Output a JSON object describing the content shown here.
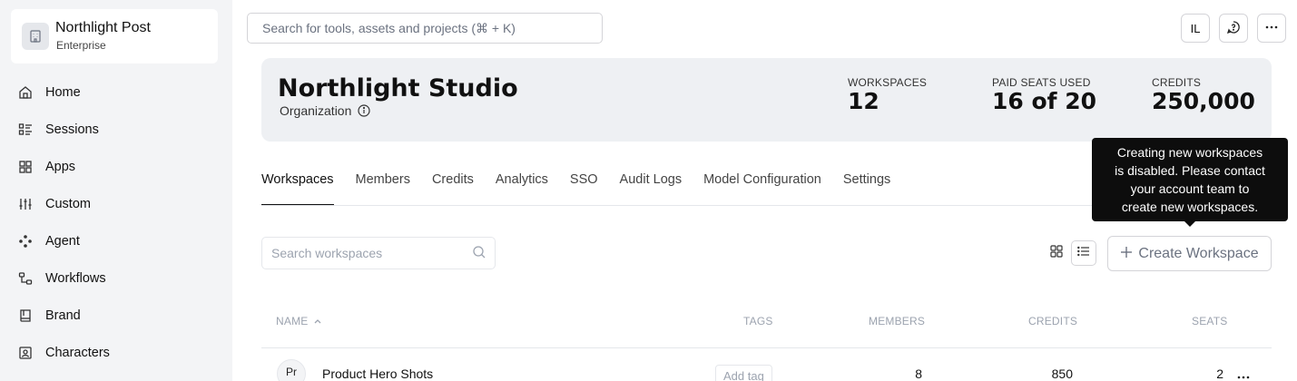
{
  "sidebar": {
    "org_name": "Northlight Post",
    "org_plan": "Enterprise",
    "items": [
      {
        "label": "Home",
        "icon": "home-icon"
      },
      {
        "label": "Sessions",
        "icon": "sessions-icon"
      },
      {
        "label": "Apps",
        "icon": "apps-grid-icon"
      },
      {
        "label": "Custom",
        "icon": "sliders-icon"
      },
      {
        "label": "Agent",
        "icon": "agent-nodes-icon"
      },
      {
        "label": "Workflows",
        "icon": "workflow-icon"
      },
      {
        "label": "Brand",
        "icon": "book-icon"
      },
      {
        "label": "Characters",
        "icon": "character-card-icon"
      }
    ]
  },
  "topbar": {
    "search_placeholder": "Search for tools, assets and projects (⌘ + K)",
    "user_initials": "IL"
  },
  "banner": {
    "title": "Northlight Studio",
    "subtitle": "Organization",
    "stats": [
      {
        "label": "WORKSPACES",
        "value": "12"
      },
      {
        "label": "PAID SEATS USED",
        "value": "16 of 20"
      },
      {
        "label": "CREDITS",
        "value": "250,000"
      }
    ]
  },
  "tabs": [
    "Workspaces",
    "Members",
    "Credits",
    "Analytics",
    "SSO",
    "Audit Logs",
    "Model Configuration",
    "Settings"
  ],
  "active_tab": "Workspaces",
  "tooltip": {
    "lines": [
      "Creating new workspaces",
      "is disabled. Please contact",
      "your account team to",
      "create new workspaces."
    ]
  },
  "toolbar": {
    "search_placeholder": "Search workspaces",
    "create_label": "Create Workspace"
  },
  "table": {
    "headers": {
      "name": "NAME",
      "tags": "TAGS",
      "members": "MEMBERS",
      "credits": "CREDITS",
      "seats": "SEATS"
    },
    "rows": [
      {
        "initials": "Pr",
        "name": "Product Hero Shots",
        "tag_label": "Add tag",
        "members": "8",
        "credits": "850",
        "seats": "2"
      }
    ]
  },
  "colors": {
    "sidebar_bg": "#f3f4f6",
    "banner_bg": "#eef0f3",
    "tooltip_bg": "#0d0d0d"
  }
}
